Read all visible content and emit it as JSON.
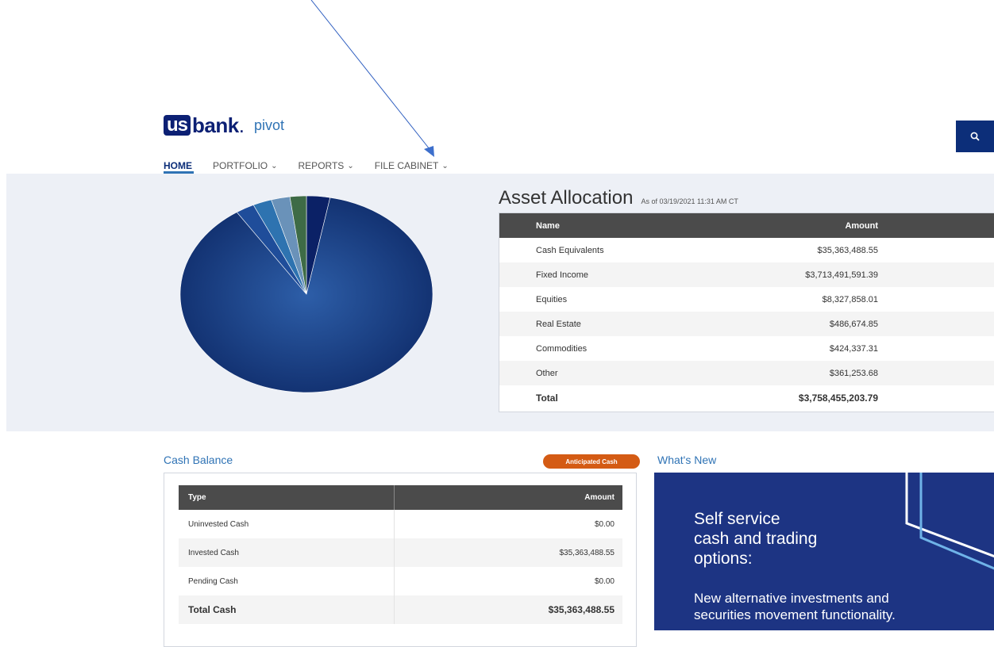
{
  "header": {
    "logo_us": "us",
    "logo_bank": "bank",
    "logo_dot": ".",
    "product": "pivot",
    "search_icon": "search-icon"
  },
  "nav": {
    "items": [
      {
        "label": "HOME",
        "active": true,
        "dropdown": false
      },
      {
        "label": "PORTFOLIO",
        "active": false,
        "dropdown": true
      },
      {
        "label": "REPORTS",
        "active": false,
        "dropdown": true
      },
      {
        "label": "FILE CABINET",
        "active": false,
        "dropdown": true
      }
    ]
  },
  "asset_allocation": {
    "title": "Asset Allocation",
    "as_of": "As of 03/19/2021 11:31 AM CT",
    "headers": {
      "name": "Name",
      "amount": "Amount"
    },
    "rows": [
      {
        "name": "Cash Equivalents",
        "amount": "$35,363,488.55"
      },
      {
        "name": "Fixed Income",
        "amount": "$3,713,491,591.39"
      },
      {
        "name": "Equities",
        "amount": "$8,327,858.01"
      },
      {
        "name": "Real Estate",
        "amount": "$486,674.85"
      },
      {
        "name": "Commodities",
        "amount": "$424,337.31"
      },
      {
        "name": "Other",
        "amount": "$361,253.68"
      }
    ],
    "total": {
      "name": "Total",
      "amount": "$3,758,455,203.79"
    }
  },
  "chart_data": {
    "type": "pie",
    "categories": [
      "Cash Equivalents",
      "Fixed Income",
      "Equities",
      "Real Estate",
      "Commodities",
      "Other"
    ],
    "values": [
      3.0,
      87.7,
      2.4,
      2.4,
      2.4,
      2.1
    ],
    "colors": [
      "#0b2166",
      "#173a86",
      "#1f4d9a",
      "#2e73b0",
      "#6a92b9",
      "#3e6b46"
    ],
    "title": "",
    "legend": "none"
  },
  "cash_balance": {
    "title": "Cash Balance",
    "anticipated_button": "Anticipated Cash",
    "headers": {
      "type": "Type",
      "amount": "Amount"
    },
    "rows": [
      {
        "type": "Uninvested Cash",
        "amount": "$0.00"
      },
      {
        "type": "Invested Cash",
        "amount": "$35,363,488.55"
      },
      {
        "type": "Pending Cash",
        "amount": "$0.00"
      }
    ],
    "total": {
      "type": "Total Cash",
      "amount": "$35,363,488.55"
    }
  },
  "whats_new": {
    "title": "What's New",
    "headline_lines": [
      "Self service",
      "cash and trading",
      "options:"
    ],
    "body_lines": [
      "New alternative investments and",
      "securities movement functionality."
    ]
  }
}
